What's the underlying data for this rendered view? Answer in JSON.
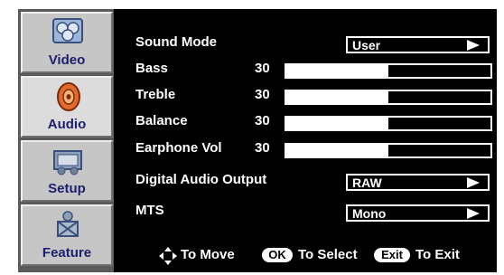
{
  "sidebar": {
    "tabs": [
      {
        "label": "Video",
        "icon": "video-icon",
        "active": false
      },
      {
        "label": "Audio",
        "icon": "speaker-icon",
        "active": true
      },
      {
        "label": "Setup",
        "icon": "setup-icon",
        "active": false
      },
      {
        "label": "Feature",
        "icon": "feature-icon",
        "active": false
      }
    ]
  },
  "audio": {
    "sound_mode": {
      "label": "Sound Mode",
      "value": "User"
    },
    "bass": {
      "label": "Bass",
      "value": "30",
      "level": 0.5
    },
    "treble": {
      "label": "Treble",
      "value": "30",
      "level": 0.5
    },
    "balance": {
      "label": "Balance",
      "value": "30",
      "level": 0.5
    },
    "earphone": {
      "label": "Earphone Vol",
      "value": "30",
      "level": 0.5
    },
    "digital_out": {
      "label": "Digital Audio Output",
      "value": "RAW"
    },
    "mts": {
      "label": "MTS",
      "value": "Mono"
    }
  },
  "help": {
    "move": "To Move",
    "ok_key": "OK",
    "select": "To Select",
    "exit_key": "Exit",
    "exit": "To Exit"
  },
  "colors": {
    "background": "#000000",
    "sidebar": "#c6c6c6",
    "tab_label": "#1e1e6e",
    "text": "#ffffff"
  }
}
